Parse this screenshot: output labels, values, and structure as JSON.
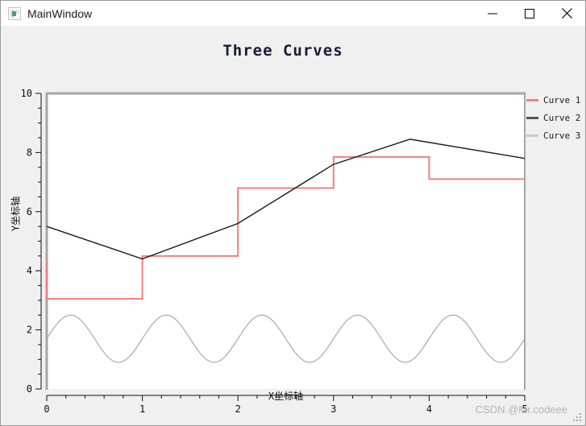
{
  "window": {
    "title": "MainWindow",
    "icon": "app-window-icon",
    "controls": {
      "minimize": "minimize-icon",
      "maximize": "maximize-icon",
      "close": "close-icon"
    }
  },
  "watermark": {
    "text": "CSDN @Mr.codeee"
  },
  "legend": {
    "position": "right",
    "items": [
      {
        "label": "Curve 1",
        "color": "#f08080"
      },
      {
        "label": "Curve 2",
        "color": "#555555"
      },
      {
        "label": "Curve 3",
        "color": "#c8c8c8"
      }
    ]
  },
  "chart_data": {
    "type": "line",
    "title": "Three Curves",
    "xlabel": "X坐标轴",
    "ylabel": "Y坐标轴",
    "xlim": [
      0,
      5
    ],
    "ylim": [
      0,
      10
    ],
    "grid": false,
    "xticks": [
      0,
      1,
      2,
      3,
      4,
      5
    ],
    "xtick_labels": [
      "0",
      "1",
      "2",
      "3",
      "4",
      "5"
    ],
    "xminor_step": 0.2,
    "yticks": [
      0,
      2,
      4,
      6,
      8,
      10
    ],
    "ytick_labels": [
      "0",
      "2",
      "4",
      "6",
      "8",
      "10"
    ],
    "yminor_step": 0.5,
    "legend_position": "right",
    "series": [
      {
        "name": "Curve 1",
        "color": "#f08080",
        "style": "step-post",
        "width": 2,
        "x": [
          0,
          0,
          1,
          1,
          2,
          2,
          3,
          3,
          4,
          4,
          5
        ],
        "y": [
          4.3,
          3.05,
          3.05,
          4.5,
          4.5,
          6.8,
          6.8,
          7.85,
          7.85,
          7.1,
          7.1
        ]
      },
      {
        "name": "Curve 2",
        "color": "#1a1a1a",
        "style": "line",
        "width": 1.4,
        "x": [
          0,
          1,
          2,
          3,
          3.8,
          5
        ],
        "y": [
          5.5,
          4.4,
          5.6,
          7.6,
          8.45,
          7.8
        ]
      },
      {
        "name": "Curve 3",
        "color": "#9a9a9a",
        "style": "sine",
        "width": 1,
        "amplitude": 0.8,
        "offset": 1.7,
        "period": 1.0,
        "phase": 0.0,
        "ymin": 0.9,
        "ymax": 2.5,
        "peaks_x": [
          0.25,
          1.25,
          2.25,
          3.25,
          4.25
        ],
        "troughs_x": [
          0.75,
          1.75,
          2.75,
          3.75,
          4.75
        ]
      }
    ]
  }
}
